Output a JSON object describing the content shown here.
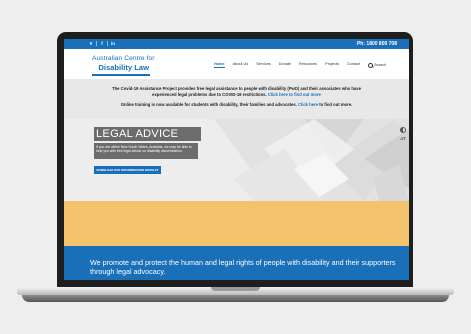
{
  "topbar": {
    "social": [
      "¥",
      "f",
      "in"
    ],
    "phone": "Ph: 1800 800 708"
  },
  "header": {
    "logo_line1": "Australian Centre for",
    "logo_line2": "Disability Law",
    "nav": [
      "Home",
      "About Us",
      "Services",
      "Donate",
      "Resources",
      "Projects",
      "Contact"
    ],
    "search_label": "Search"
  },
  "notice": {
    "line1": "The Covid-19 Assistance Project provides free legal assistance to people with disability (PwD) and their associates who have experienced legal problems due to COVID-19 restrictions.",
    "line1_link": "Click here to find out more",
    "line2": "Online training is now available for students with disability, their families and advocates.",
    "line2_link": "Click here",
    "line2_end": " to find out more."
  },
  "hero": {
    "title": "LEGAL ADVICE",
    "text": "If you are within New South Wales, Australia, we may be able to help you with free legal advice on disability discrimination.",
    "button": "DOWNLOAD OUR DISCRIMINATION BOOKLET"
  },
  "accessibility": {
    "text_size": "aT"
  },
  "mission": {
    "text": "We promote and protect the human and legal rights of people with disability and their supporters through legal advocacy."
  },
  "colors": {
    "brand_blue": "#1a6fb9",
    "band_orange": "#f2c26d"
  }
}
